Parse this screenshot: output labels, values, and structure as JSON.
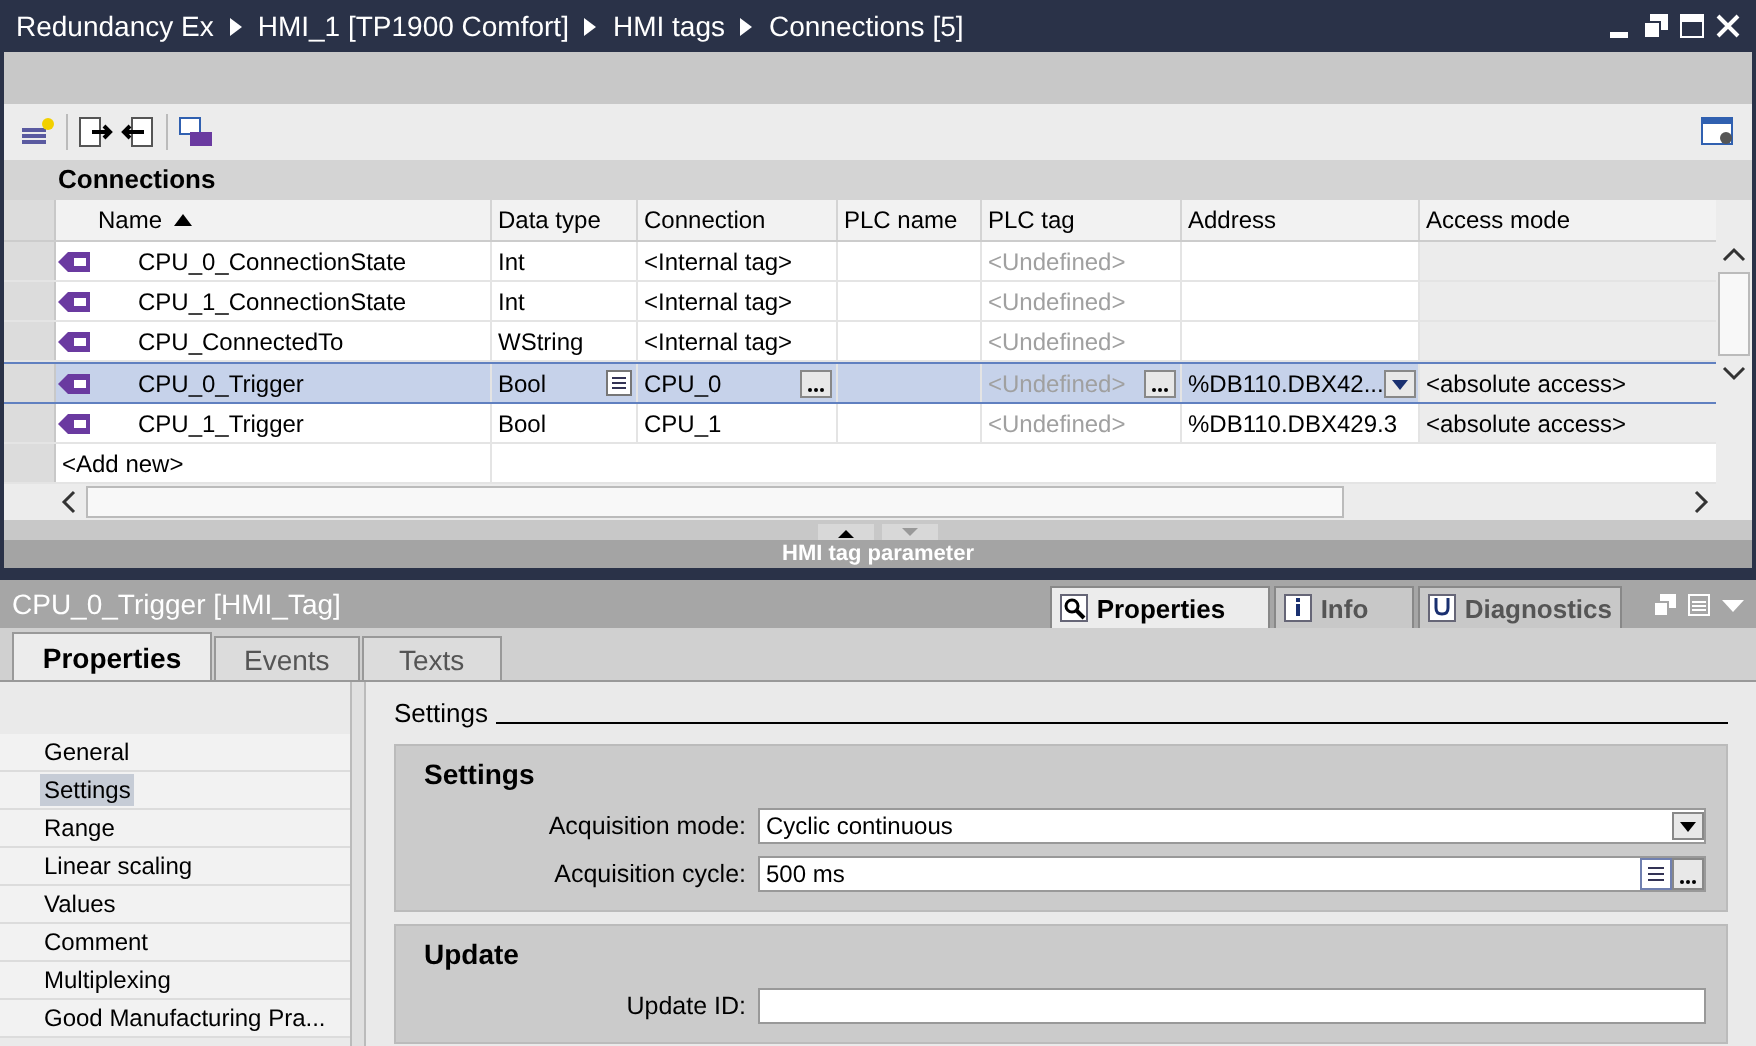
{
  "window": {
    "breadcrumb": [
      "Redundancy Ex",
      "HMI_1 [TP1900 Comfort]",
      "HMI tags",
      "Connections [5]"
    ]
  },
  "editor": {
    "title": "Connections",
    "columns": [
      "Name",
      "Data type",
      "Connection",
      "PLC name",
      "PLC tag",
      "Address",
      "Access mode"
    ],
    "rows": [
      {
        "name": "CPU_0_ConnectionState",
        "data_type": "Int",
        "connection": "<Internal tag>",
        "plc_tag": "<Undefined>",
        "selected": false
      },
      {
        "name": "CPU_1_ConnectionState",
        "data_type": "Int",
        "connection": "<Internal tag>",
        "plc_tag": "<Undefined>",
        "selected": false
      },
      {
        "name": "CPU_ConnectedTo",
        "data_type": "WString",
        "connection": "<Internal tag>",
        "plc_tag": "<Undefined>",
        "selected": false
      },
      {
        "name": "CPU_0_Trigger",
        "data_type": "Bool",
        "connection": "CPU_0",
        "plc_tag": "<Undefined>",
        "address": "%DB110.DBX42...",
        "access_mode": "<absolute access>",
        "selected": true
      },
      {
        "name": "CPU_1_Trigger",
        "data_type": "Bool",
        "connection": "CPU_1",
        "plc_tag": "<Undefined>",
        "address": "%DB110.DBX429.3",
        "access_mode": "<absolute access>",
        "selected": false
      }
    ],
    "add_new": "<Add new>",
    "splitter_label": "HMI tag parameter"
  },
  "inspector": {
    "title": "CPU_0_Trigger [HMI_Tag]",
    "view_tabs": [
      {
        "label": "Properties",
        "selected": true
      },
      {
        "label": "Info",
        "selected": false
      },
      {
        "label": "Diagnostics",
        "selected": false
      }
    ],
    "tabs": [
      {
        "label": "Properties",
        "selected": true
      },
      {
        "label": "Events",
        "selected": false
      },
      {
        "label": "Texts",
        "selected": false
      }
    ],
    "nav": [
      {
        "label": "General",
        "selected": false
      },
      {
        "label": "Settings",
        "selected": true
      },
      {
        "label": "Range",
        "selected": false
      },
      {
        "label": "Linear scaling",
        "selected": false
      },
      {
        "label": "Values",
        "selected": false
      },
      {
        "label": "Comment",
        "selected": false
      },
      {
        "label": "Multiplexing",
        "selected": false
      },
      {
        "label": "Good Manufacturing Pra...",
        "selected": false
      }
    ],
    "section": "Settings",
    "groups": [
      {
        "title": "Settings",
        "fields": [
          {
            "label": "Acquisition mode:",
            "value": "Cyclic continuous",
            "kind": "dropdown"
          },
          {
            "label": "Acquisition cycle:",
            "value": "500 ms",
            "kind": "picker"
          }
        ]
      },
      {
        "title": "Update",
        "fields": [
          {
            "label": "Update ID:",
            "kind": "text"
          }
        ]
      }
    ]
  }
}
